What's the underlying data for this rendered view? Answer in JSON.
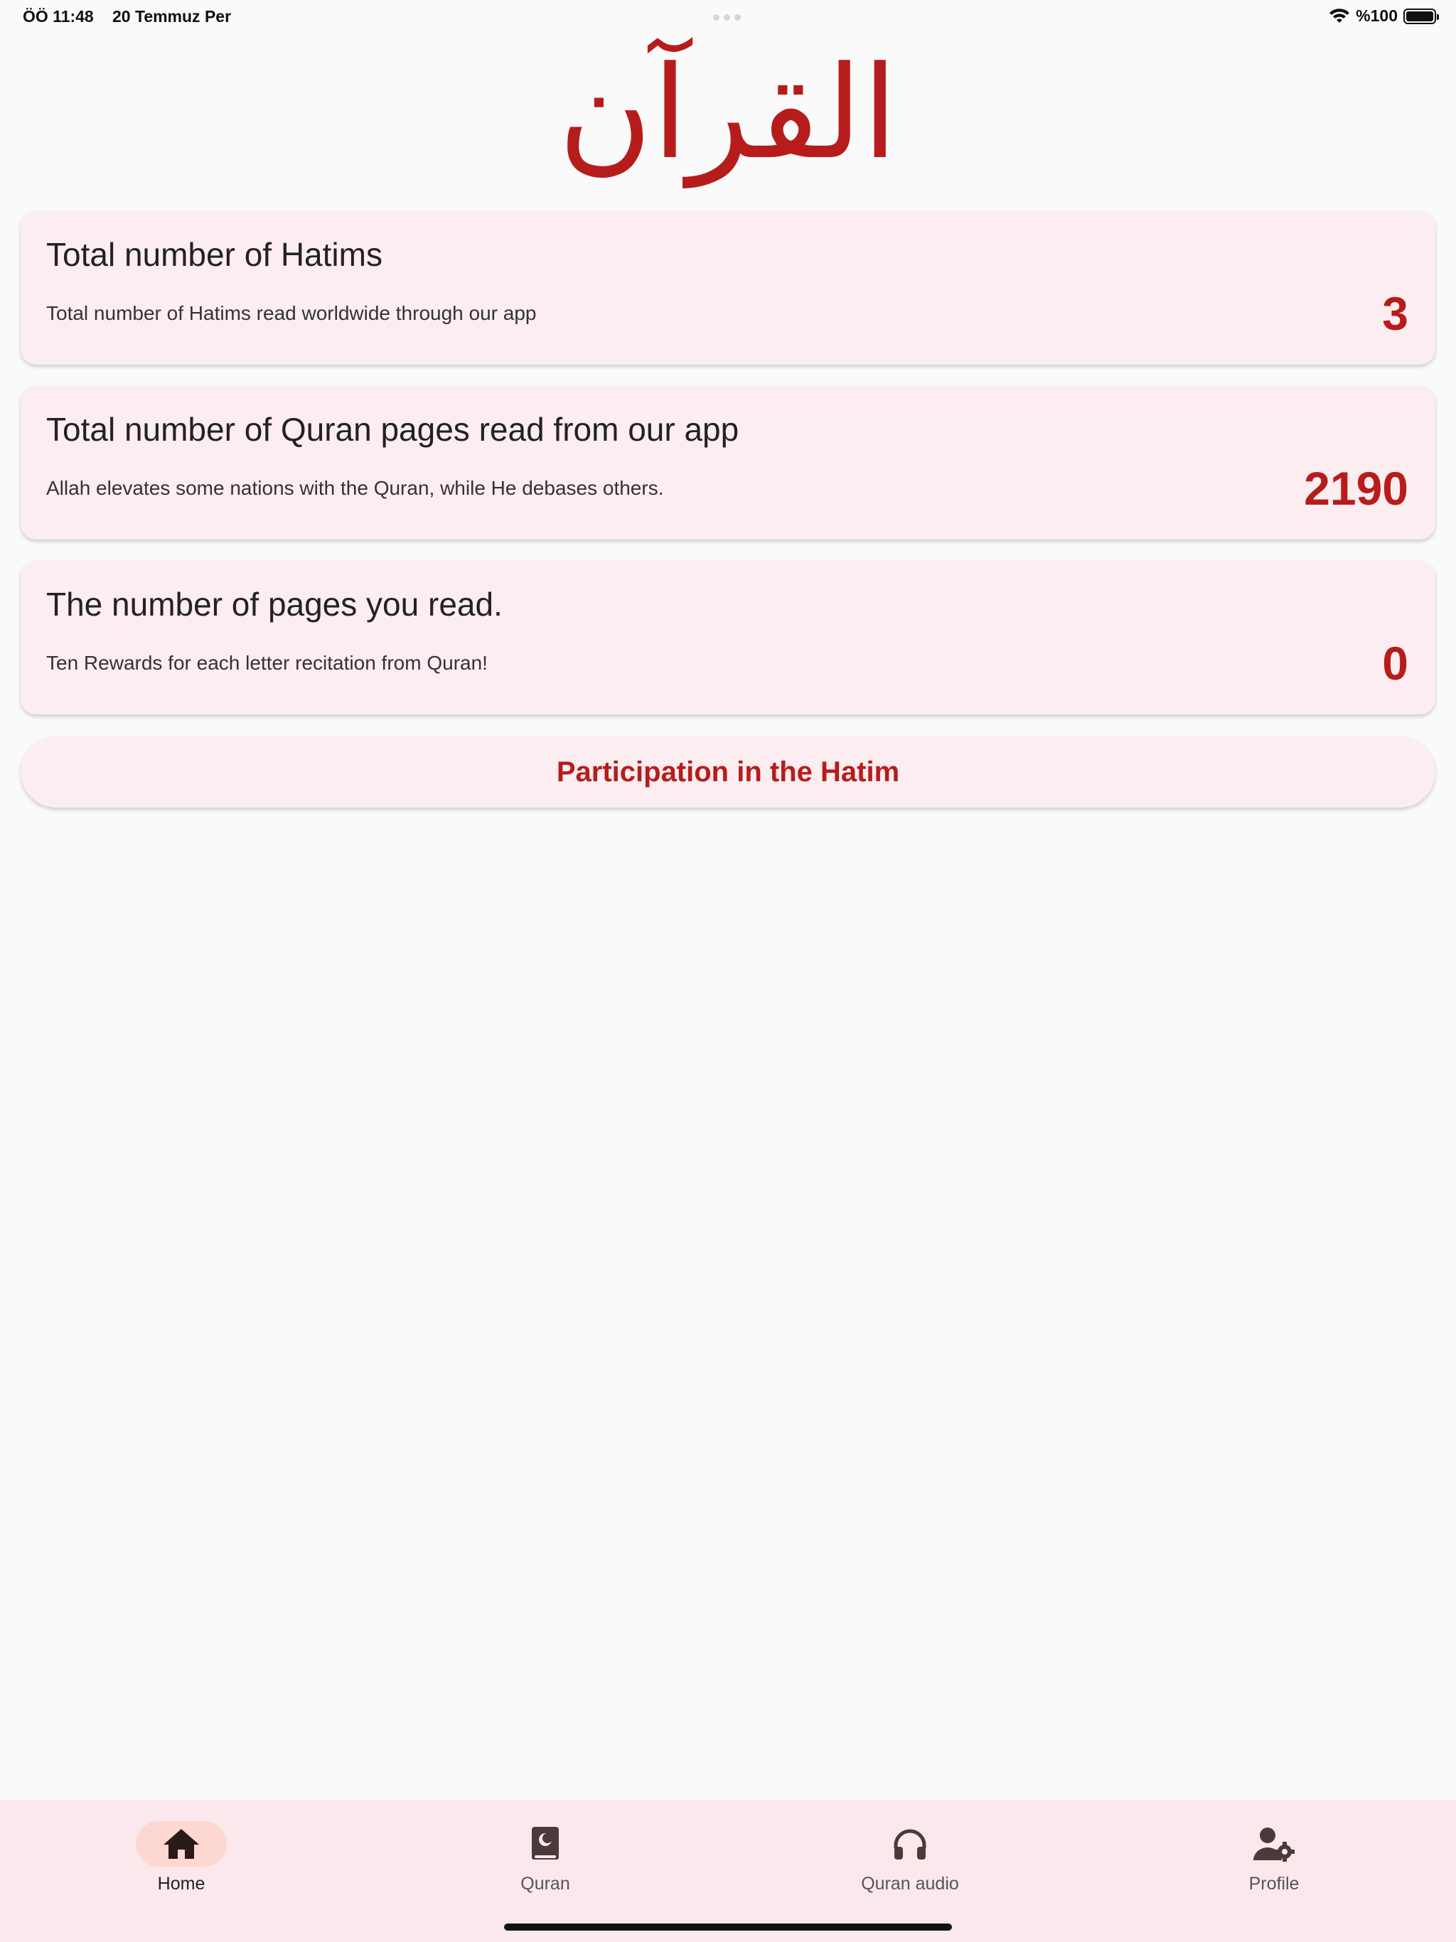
{
  "status_bar": {
    "time": "ÖÖ 11:48",
    "date": "20 Temmuz Per",
    "battery": "%100"
  },
  "header": {
    "title": "القرآن"
  },
  "cards": [
    {
      "title": "Total number of Hatims",
      "subtitle": "Total number of Hatims read worldwide through our app",
      "value": "3"
    },
    {
      "title": "Total number of Quran pages read from our app",
      "subtitle": "Allah elevates some nations with the Quran, while He debases others.",
      "value": "2190"
    },
    {
      "title": "The number of pages you read.",
      "subtitle": "Ten Rewards for each letter recitation from Quran!",
      "value": "0"
    }
  ],
  "actions": {
    "participate_label": "Participation in the Hatim"
  },
  "nav": {
    "items": [
      {
        "label": "Home",
        "icon": "home-icon",
        "active": true
      },
      {
        "label": "Quran",
        "icon": "quran-book-icon",
        "active": false
      },
      {
        "label": "Quran audio",
        "icon": "headphones-icon",
        "active": false
      },
      {
        "label": "Profile",
        "icon": "profile-settings-icon",
        "active": false
      }
    ]
  },
  "colors": {
    "accent": "#b71c1c",
    "card_bg": "#fcedf0",
    "nav_bg": "#fbe8ec",
    "active_pill": "#fdd7d1",
    "page_bg": "#fafafa"
  }
}
